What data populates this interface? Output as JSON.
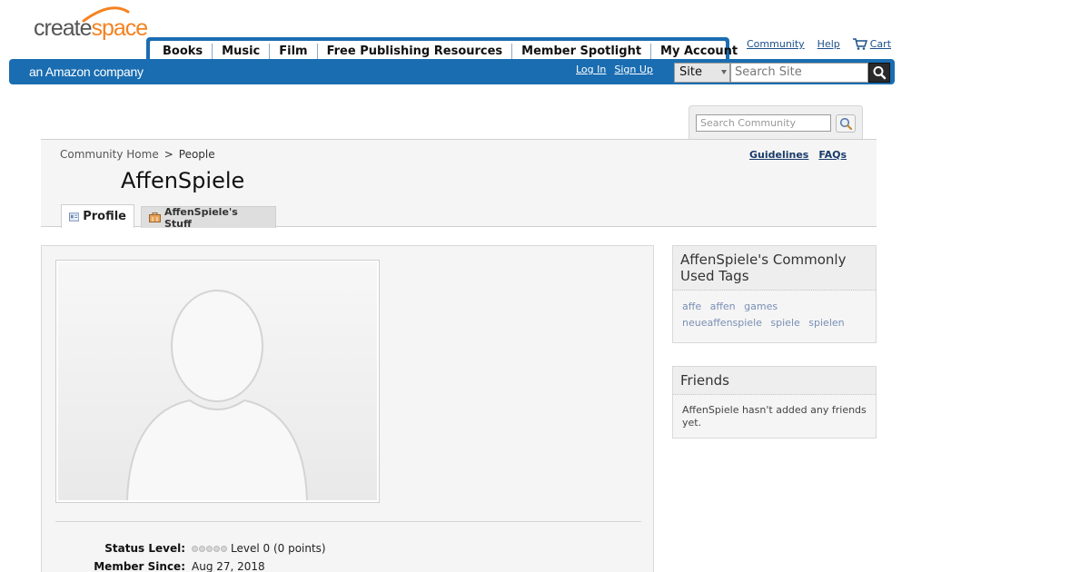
{
  "brand": {
    "logo_part1": "create",
    "logo_part2": "space",
    "tagline": "an Amazon company",
    "orange": "#f58220",
    "blue": "#1a6db1"
  },
  "nav": {
    "tabs": [
      "Books",
      "Music",
      "Film",
      "Free Publishing Resources",
      "Member Spotlight",
      "My Account"
    ]
  },
  "top_links": {
    "community": "Community",
    "help": "Help",
    "cart": "Cart",
    "cart_icon": "cart-icon"
  },
  "auth": {
    "login": "Log In",
    "signup": "Sign Up"
  },
  "site_search": {
    "scope": "Site",
    "placeholder": "Search Site",
    "button_icon": "search-icon"
  },
  "community_search": {
    "placeholder": "Search Community",
    "button_icon": "magnifier-icon"
  },
  "breadcrumb": {
    "home": "Community Home",
    "separator": ">",
    "current": "People"
  },
  "guide_links": {
    "guidelines": "Guidelines",
    "faqs": "FAQs"
  },
  "profile": {
    "username": "AffenSpiele",
    "tabs": {
      "profile": "Profile",
      "stuff": "AffenSpiele's Stuff"
    },
    "status_label": "Status Level:",
    "status_value": "Level 0 (0 points)",
    "member_since_label": "Member Since:",
    "member_since_value": "Aug 27, 2018"
  },
  "sidebar": {
    "tags_title": "AffenSpiele's Commonly Used Tags",
    "tags": [
      "affe",
      "affen",
      "games",
      "neueaffenspiele",
      "spiele",
      "spielen"
    ],
    "friends_title": "Friends",
    "friends_text": "AffenSpiele hasn't added any friends yet."
  }
}
